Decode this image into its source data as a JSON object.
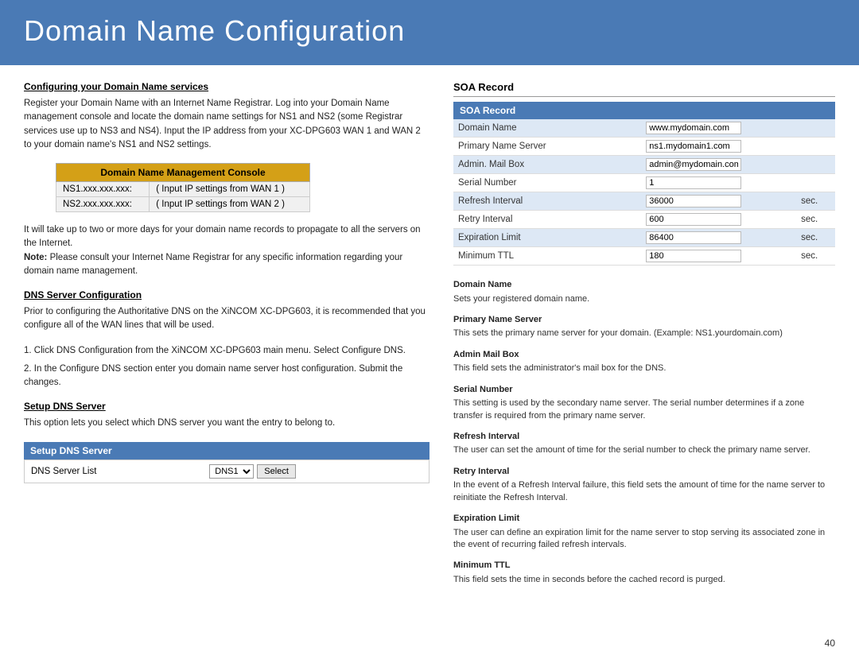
{
  "page": {
    "title": "Domain Name Configuration",
    "page_number": "40"
  },
  "left": {
    "section1": {
      "heading": "Configuring your Domain Name services",
      "text": "Register your Domain Name with an Internet Name Registrar. Log into your Domain Name management console and locate the domain name settings for NS1 and NS2 (some Registrar services use up to NS3 and NS4).  Input the IP address from your XC-DPG603 WAN 1 and WAN 2 to your domain name's NS1 and NS2 settings."
    },
    "dns_console_table": {
      "header": "Domain Name Management Console",
      "rows": [
        {
          "col1": "NS1.xxx.xxx.xxx:",
          "col2": "( Input IP settings from WAN 1 )"
        },
        {
          "col1": "NS2.xxx.xxx.xxx:",
          "col2": "( Input IP settings from WAN 2 )"
        }
      ]
    },
    "section1_extra": "It will take up to two or more days for your domain name records to propagate to all the servers on the Internet.",
    "section1_note_bold": "Note:",
    "section1_note": " Please consult your Internet Name Registrar for any specific information regarding your domain name management.",
    "section2": {
      "heading": "DNS Server Configuration",
      "text": "Prior to configuring the Authoritative DNS on the XiNCOM XC-DPG603, it is recommended that you configure all of the WAN lines that will be used."
    },
    "steps": [
      "1. Click DNS Configuration from the XiNCOM XC-DPG603 main menu. Select Configure DNS.",
      "2. In the Configure DNS section enter you domain name server host configuration. Submit the changes."
    ],
    "section3": {
      "heading": "Setup DNS Server",
      "text": "This option lets you select which DNS server you want the entry to belong to."
    },
    "setup_dns_table": {
      "header": "Setup DNS Server",
      "label": "DNS Server List",
      "dropdown_value": "DNS1",
      "select_button": "Select"
    }
  },
  "right": {
    "soa_section_title": "SOA Record",
    "soa_table": {
      "header": "SOA Record",
      "rows": [
        {
          "label": "Domain Name",
          "value": "www.mydomain.com",
          "unit": ""
        },
        {
          "label": "Primary Name Server",
          "value": "ns1.mydomain1.com",
          "unit": ""
        },
        {
          "label": "Admin. Mail Box",
          "value": "admin@mydomain.com",
          "unit": ""
        },
        {
          "label": "Serial Number",
          "value": "1",
          "unit": ""
        },
        {
          "label": "Refresh Interval",
          "value": "36000",
          "unit": "sec."
        },
        {
          "label": "Retry Interval",
          "value": "600",
          "unit": "sec."
        },
        {
          "label": "Expiration Limit",
          "value": "86400",
          "unit": "sec."
        },
        {
          "label": "Minimum TTL",
          "value": "180",
          "unit": "sec."
        }
      ]
    },
    "help_items": [
      {
        "title": "Domain Name",
        "text": "Sets your registered domain name."
      },
      {
        "title": "Primary Name Server",
        "text": "This sets the primary name server for your domain.  (Example: NS1.yourdomain.com)"
      },
      {
        "title": "Admin Mail Box",
        "text": "This field sets the administrator's mail box for the DNS."
      },
      {
        "title": "Serial Number",
        "text": "This setting is used by the secondary name server.  The serial number determines if a zone transfer is required from the primary name server."
      },
      {
        "title": "Refresh Interval",
        "text": "The user can set the amount of time for the serial number to check the primary name server."
      },
      {
        "title": "Retry Interval",
        "text": "In the event of a Refresh Interval failure, this field sets the amount of time for the name server to reinitiate the Refresh Interval."
      },
      {
        "title": "Expiration Limit",
        "text": "The user can define an expiration limit for the name server to stop serving its associated zone in the event of recurring failed refresh intervals."
      },
      {
        "title": "Minimum TTL",
        "text": "This field sets the time in seconds before the cached record is purged."
      }
    ]
  }
}
